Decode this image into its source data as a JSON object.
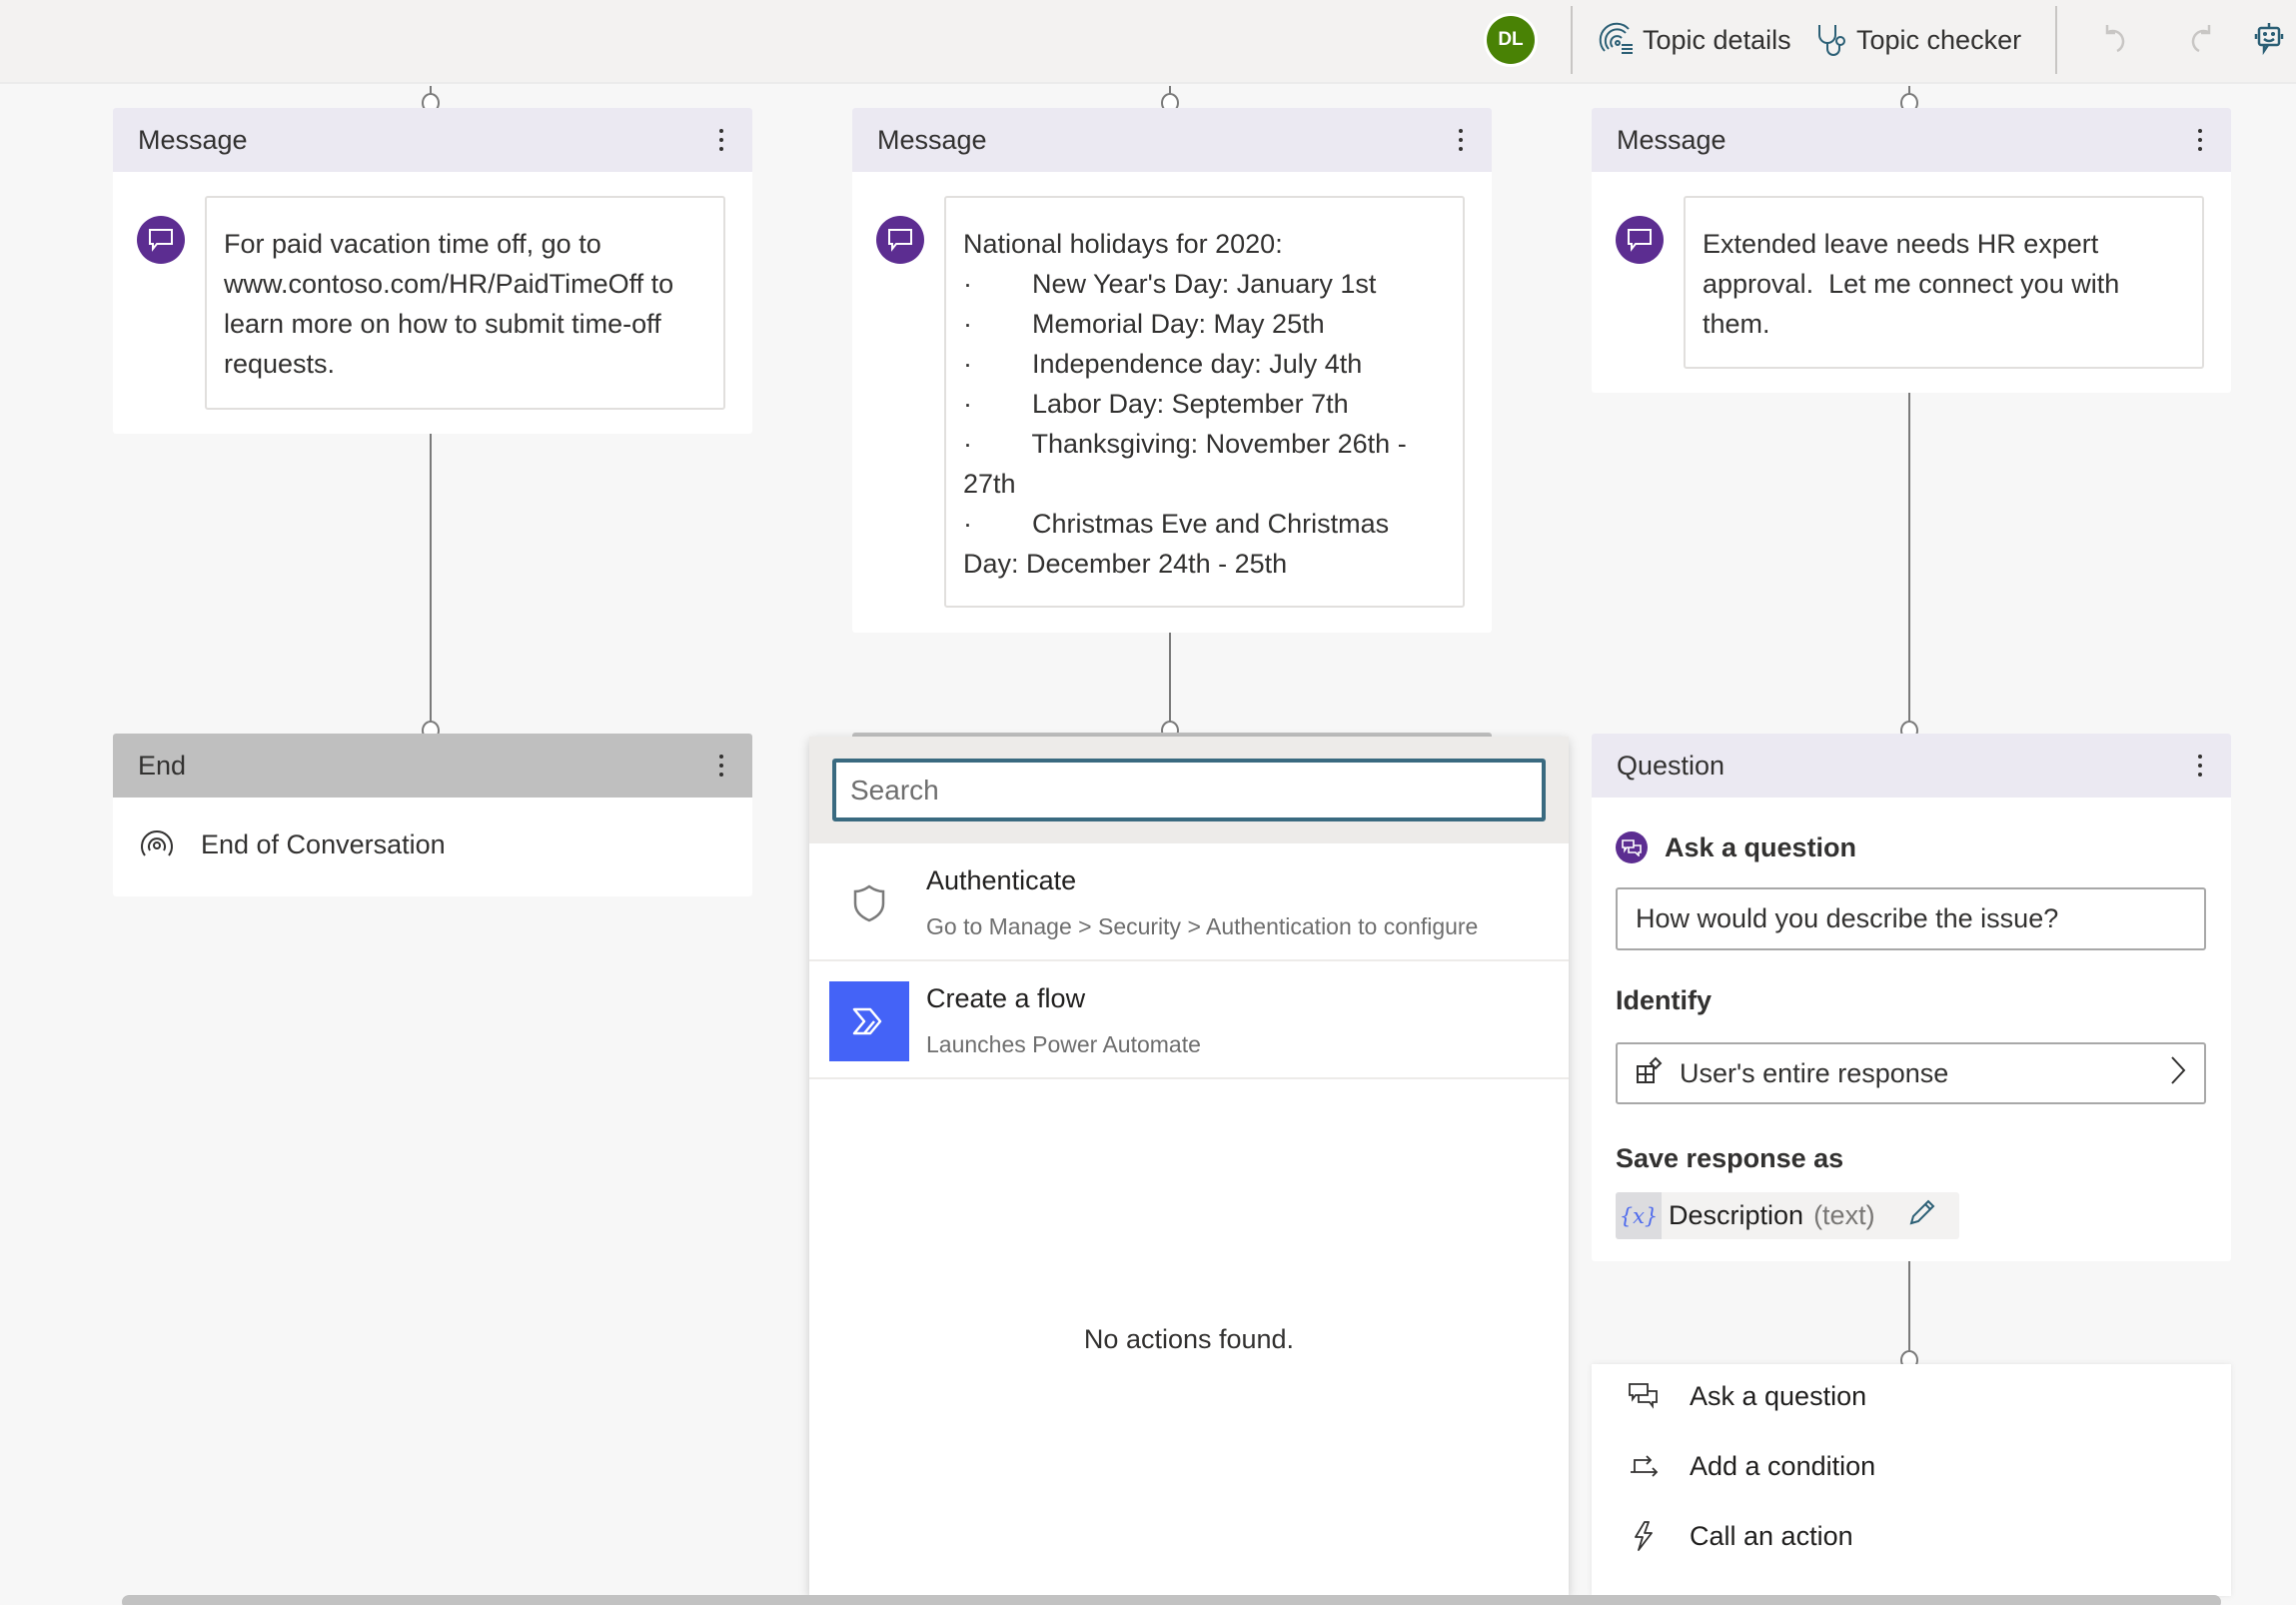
{
  "topbar": {
    "avatar_initials": "DL",
    "avatar_color": "#498205",
    "topic_details_label": "Topic details",
    "topic_checker_label": "Topic checker",
    "icons": [
      "topic-details-icon",
      "stethoscope-icon",
      "undo-icon",
      "redo-icon",
      "bot-icon"
    ]
  },
  "nodes": {
    "message_1": {
      "title": "Message",
      "text": "For paid vacation time off, go to www.contoso.com/HR/PaidTimeOff to learn more on how to submit time-off requests."
    },
    "message_2": {
      "title": "Message",
      "text": "National holidays for 2020:\n·        New Year's Day: January 1st\n·        Memorial Day: May 25th\n·        Independence day: July 4th\n·        Labor Day: September 7th\n·        Thanksgiving: November 26th - 27th\n·        Christmas Eve and Christmas Day: December 24th - 25th"
    },
    "message_3": {
      "title": "Message",
      "text": "Extended leave needs HR expert approval.  Let me connect you with them."
    },
    "end": {
      "title": "End",
      "item": "End of Conversation"
    },
    "question": {
      "title": "Question",
      "ask_label": "Ask a question",
      "question_text": "How would you describe the issue?",
      "identify_label": "Identify",
      "identify_value": "User's entire response",
      "save_label": "Save response as",
      "variable_icon": "{x}",
      "variable_name": "Description",
      "variable_type": "(text)"
    }
  },
  "action_picker": {
    "search_placeholder": "Search",
    "search_value": "",
    "items": [
      {
        "title": "Authenticate",
        "subtitle": "Go to Manage > Security > Authentication to configure",
        "icon": "shield-icon"
      },
      {
        "title": "Create a flow",
        "subtitle": "Launches Power Automate",
        "icon": "power-automate-icon"
      }
    ],
    "empty_message": "No actions found."
  },
  "add_menu": {
    "items": [
      {
        "label": "Ask a question",
        "icon": "ask-question-icon"
      },
      {
        "label": "Add a condition",
        "icon": "condition-icon"
      },
      {
        "label": "Call an action",
        "icon": "lightning-icon"
      }
    ]
  },
  "colors": {
    "accent_purple": "#5c2d91",
    "header_lavender": "#ebe9f2",
    "end_header_gray": "#bfbfbf",
    "search_border": "#3a6a80",
    "flow_blue": "#4463f7",
    "variable_blue": "#4f6bed"
  }
}
